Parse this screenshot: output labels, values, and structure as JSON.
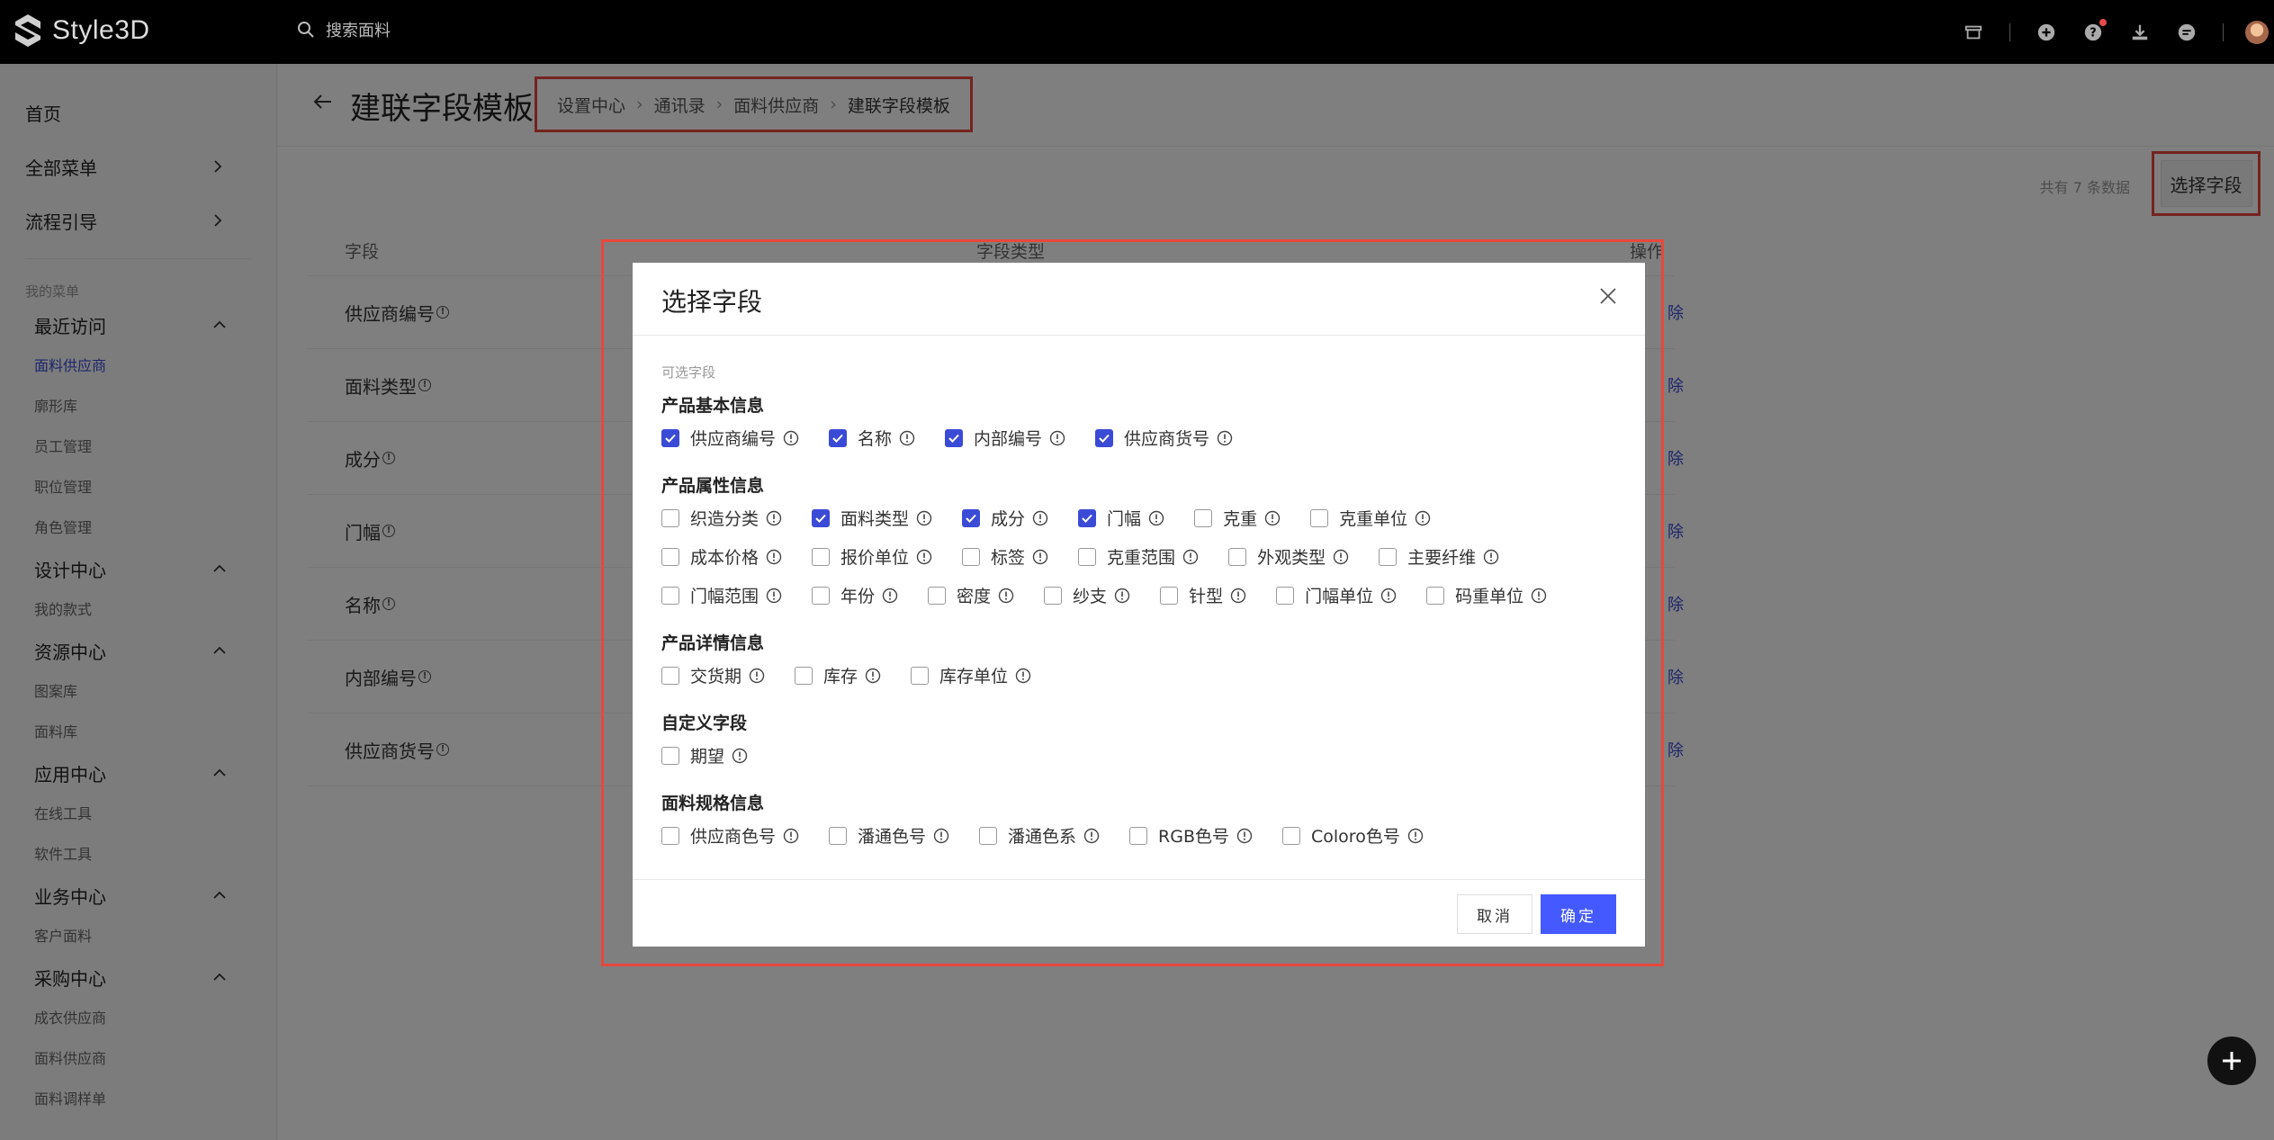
{
  "topbar": {
    "logo_text": "Style3D",
    "search_placeholder": "搜索面料"
  },
  "sidebar": {
    "top_items": [
      {
        "label": "首页"
      },
      {
        "label": "全部菜单"
      },
      {
        "label": "流程引导"
      }
    ],
    "my_menu_label": "我的菜单",
    "groups": [
      {
        "label": "最近访问",
        "items": [
          "面料供应商",
          "廓形库",
          "员工管理",
          "职位管理",
          "角色管理"
        ]
      },
      {
        "label": "设计中心",
        "items": [
          "我的款式"
        ]
      },
      {
        "label": "资源中心",
        "items": [
          "图案库",
          "面料库"
        ]
      },
      {
        "label": "应用中心",
        "items": [
          "在线工具",
          "软件工具"
        ]
      },
      {
        "label": "业务中心",
        "items": [
          "客户面料"
        ]
      },
      {
        "label": "采购中心",
        "items": [
          "成衣供应商",
          "面料供应商",
          "面料调样单"
        ]
      }
    ],
    "active_item": "面料供应商"
  },
  "page": {
    "title": "建联字段模板",
    "breadcrumb": [
      "设置中心",
      "通讯录",
      "面料供应商",
      "建联字段模板"
    ],
    "count_text": "共有 7 条数据",
    "select_button": "选择字段",
    "table": {
      "headers": {
        "field": "字段",
        "type": "字段类型",
        "op": "操作"
      },
      "rows": [
        "供应商编号",
        "面料类型",
        "成分",
        "门幅",
        "名称",
        "内部编号",
        "供应商货号"
      ],
      "op_label": "除"
    }
  },
  "dialog": {
    "title": "选择字段",
    "subtitle": "可选字段",
    "sections": [
      {
        "title": "产品基本信息",
        "rows": [
          [
            {
              "label": "供应商编号",
              "checked": true
            },
            {
              "label": "名称",
              "checked": true
            },
            {
              "label": "内部编号",
              "checked": true
            },
            {
              "label": "供应商货号",
              "checked": true
            }
          ]
        ]
      },
      {
        "title": "产品属性信息",
        "rows": [
          [
            {
              "label": "织造分类",
              "checked": false
            },
            {
              "label": "面料类型",
              "checked": true
            },
            {
              "label": "成分",
              "checked": true
            },
            {
              "label": "门幅",
              "checked": true
            },
            {
              "label": "克重",
              "checked": false
            },
            {
              "label": "克重单位",
              "checked": false
            }
          ],
          [
            {
              "label": "成本价格",
              "checked": false
            },
            {
              "label": "报价单位",
              "checked": false
            },
            {
              "label": "标签",
              "checked": false
            },
            {
              "label": "克重范围",
              "checked": false
            },
            {
              "label": "外观类型",
              "checked": false
            },
            {
              "label": "主要纤维",
              "checked": false
            }
          ],
          [
            {
              "label": "门幅范围",
              "checked": false
            },
            {
              "label": "年份",
              "checked": false
            },
            {
              "label": "密度",
              "checked": false
            },
            {
              "label": "纱支",
              "checked": false
            },
            {
              "label": "针型",
              "checked": false
            },
            {
              "label": "门幅单位",
              "checked": false
            },
            {
              "label": "码重单位",
              "checked": false
            }
          ]
        ]
      },
      {
        "title": "产品详情信息",
        "rows": [
          [
            {
              "label": "交货期",
              "checked": false
            },
            {
              "label": "库存",
              "checked": false
            },
            {
              "label": "库存单位",
              "checked": false
            }
          ]
        ]
      },
      {
        "title": "自定义字段",
        "rows": [
          [
            {
              "label": "期望",
              "checked": false
            }
          ]
        ]
      },
      {
        "title": "面料规格信息",
        "rows": [
          [
            {
              "label": "供应商色号",
              "checked": false
            },
            {
              "label": "潘通色号",
              "checked": false
            },
            {
              "label": "潘通色系",
              "checked": false
            },
            {
              "label": "RGB色号",
              "checked": false
            },
            {
              "label": "Coloro色号",
              "checked": false
            }
          ]
        ]
      }
    ],
    "cancel": "取消",
    "ok": "确定"
  },
  "colors": {
    "accent": "#4459ff",
    "highlight": "#e8473e"
  }
}
